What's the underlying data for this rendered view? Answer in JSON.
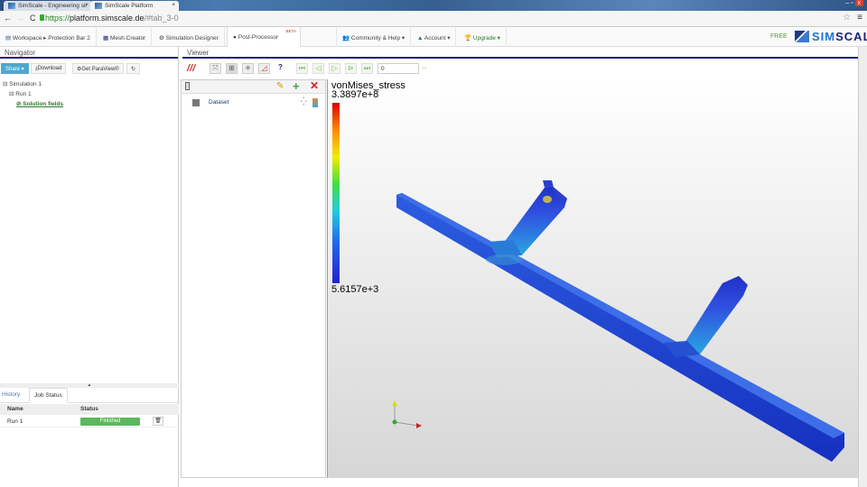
{
  "browser": {
    "tabs": [
      {
        "title": "SimScale - Engineering sir"
      },
      {
        "title": "SimScale Platform"
      }
    ],
    "url_scheme": "https://",
    "url_host": "platform.simscale.de",
    "url_path": "/#tab_3-0"
  },
  "topnav": {
    "workspace": "Workspace",
    "project": "Protection Bar 2",
    "mesh_creator": "Mesh Creator",
    "simulation_designer": "Simulation Designer",
    "post_processor": "Post-Processor",
    "beta": "BETA",
    "community": "Community & Help",
    "account": "Account",
    "upgrade": "Upgrade",
    "plan": "FREE",
    "logo": "SIMSCALE"
  },
  "navigator": {
    "title": "Navigator",
    "share": "Share",
    "download": "Download",
    "paraview": "Get ParaView®",
    "tree": {
      "simulation": "Simulation 1",
      "run": "Run 1",
      "fields": "Solution fields"
    }
  },
  "viewer": {
    "title": "Viewer",
    "time_value": "0",
    "pipeline": {
      "dataset": "Dataset"
    },
    "legend": {
      "field": "vonMises_stress",
      "max": "3.3897e+8",
      "min": "5.6157e+3"
    },
    "colors": {
      "accent": "#1a237e"
    }
  },
  "jobs": {
    "tabs": [
      "History",
      "Job Status"
    ],
    "columns": [
      "Name",
      "Status"
    ],
    "rows": [
      {
        "name": "Run 1",
        "status": "Finished"
      }
    ]
  }
}
